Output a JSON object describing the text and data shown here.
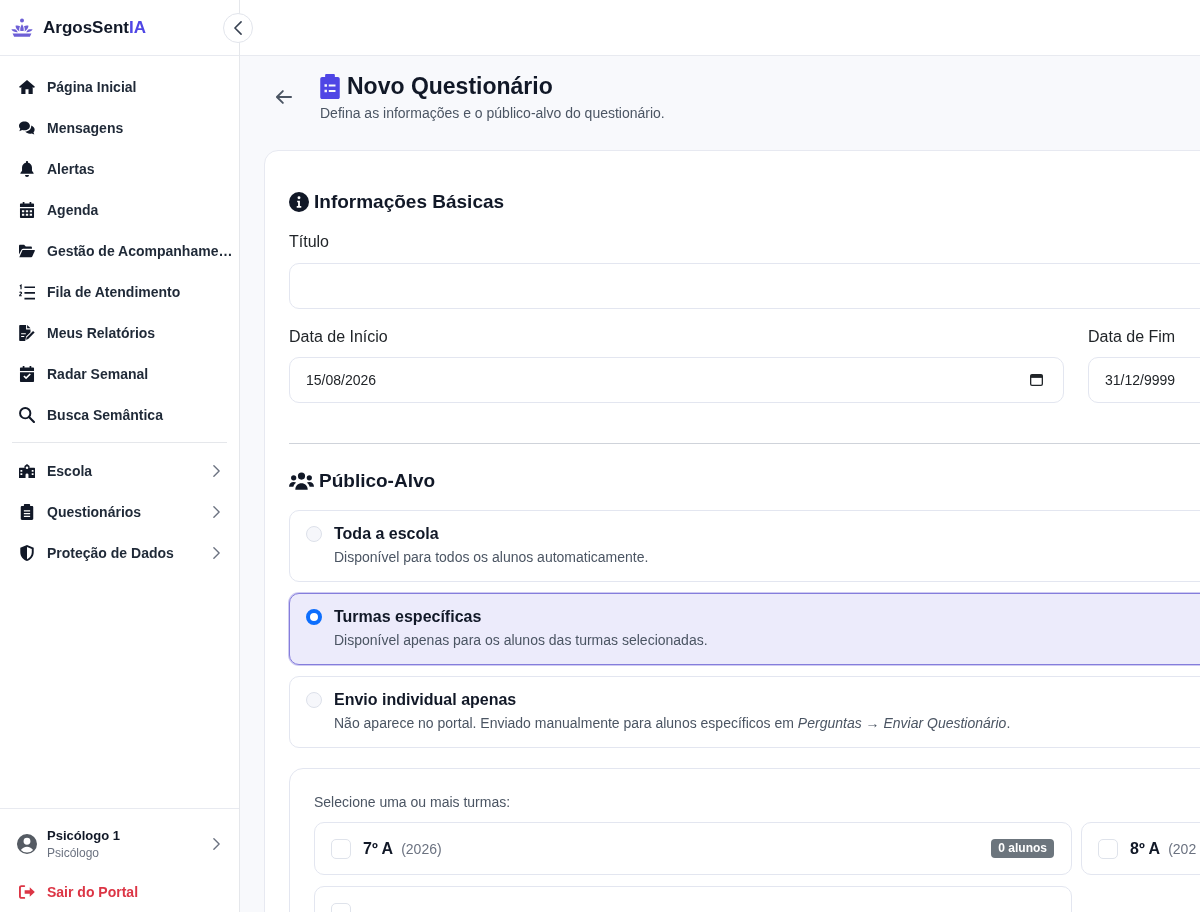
{
  "sidebar": {
    "brand": {
      "name": "ArgosSent",
      "accent": "IA"
    },
    "sections": [
      {
        "items": [
          {
            "label": "Página Inicial",
            "kind": "link"
          },
          {
            "label": "Mensagens",
            "kind": "link"
          },
          {
            "label": "Alertas",
            "kind": "link"
          },
          {
            "label": "Agenda",
            "kind": "link"
          },
          {
            "label": "Gestão de Acompanhame…",
            "kind": "link"
          },
          {
            "label": "Fila de Atendimento",
            "kind": "link"
          },
          {
            "label": "Meus Relatórios",
            "kind": "link"
          },
          {
            "label": "Radar Semanal",
            "kind": "link"
          },
          {
            "label": "Busca Semântica",
            "kind": "link"
          }
        ]
      },
      {
        "items": [
          {
            "label": "Escola",
            "kind": "group"
          },
          {
            "label": "Questionários",
            "kind": "group"
          },
          {
            "label": "Proteção de Dados",
            "kind": "group"
          }
        ]
      }
    ],
    "user": {
      "name": "Psicólogo 1",
      "role": "Psicólogo"
    },
    "logout": "Sair do Portal"
  },
  "page": {
    "title": "Novo Questionário",
    "subtitle": "Defina as informações e o público-alvo do questionário."
  },
  "basic_info": {
    "heading": "Informações Básicas",
    "title_label": "Título",
    "start_label": "Data de Início",
    "start_value": "15/08/2026",
    "end_label": "Data de Fim",
    "end_value": "31/12/9999"
  },
  "audience": {
    "heading": "Público-Alvo",
    "options": [
      {
        "title": "Toda a escola",
        "description": "Disponível para todos os alunos automaticamente.",
        "selected": false
      },
      {
        "title": "Turmas específicas",
        "description": "Disponível apenas para os alunos das turmas selecionadas.",
        "selected": true
      },
      {
        "title": "Envio individual apenas",
        "description": "Não aparece no portal. Enviado manualmente para alunos específicos em *Perguntas → Enviar Questionário*.",
        "selected": false
      }
    ],
    "classes_prompt": "Selecione uma ou mais turmas:",
    "classes": [
      {
        "name": "7º A",
        "year": "(2026)",
        "count": "0 alunos",
        "checked": false
      },
      {
        "name": "8º A",
        "year": "(202",
        "checked": false
      },
      {
        "checked": false
      }
    ]
  }
}
